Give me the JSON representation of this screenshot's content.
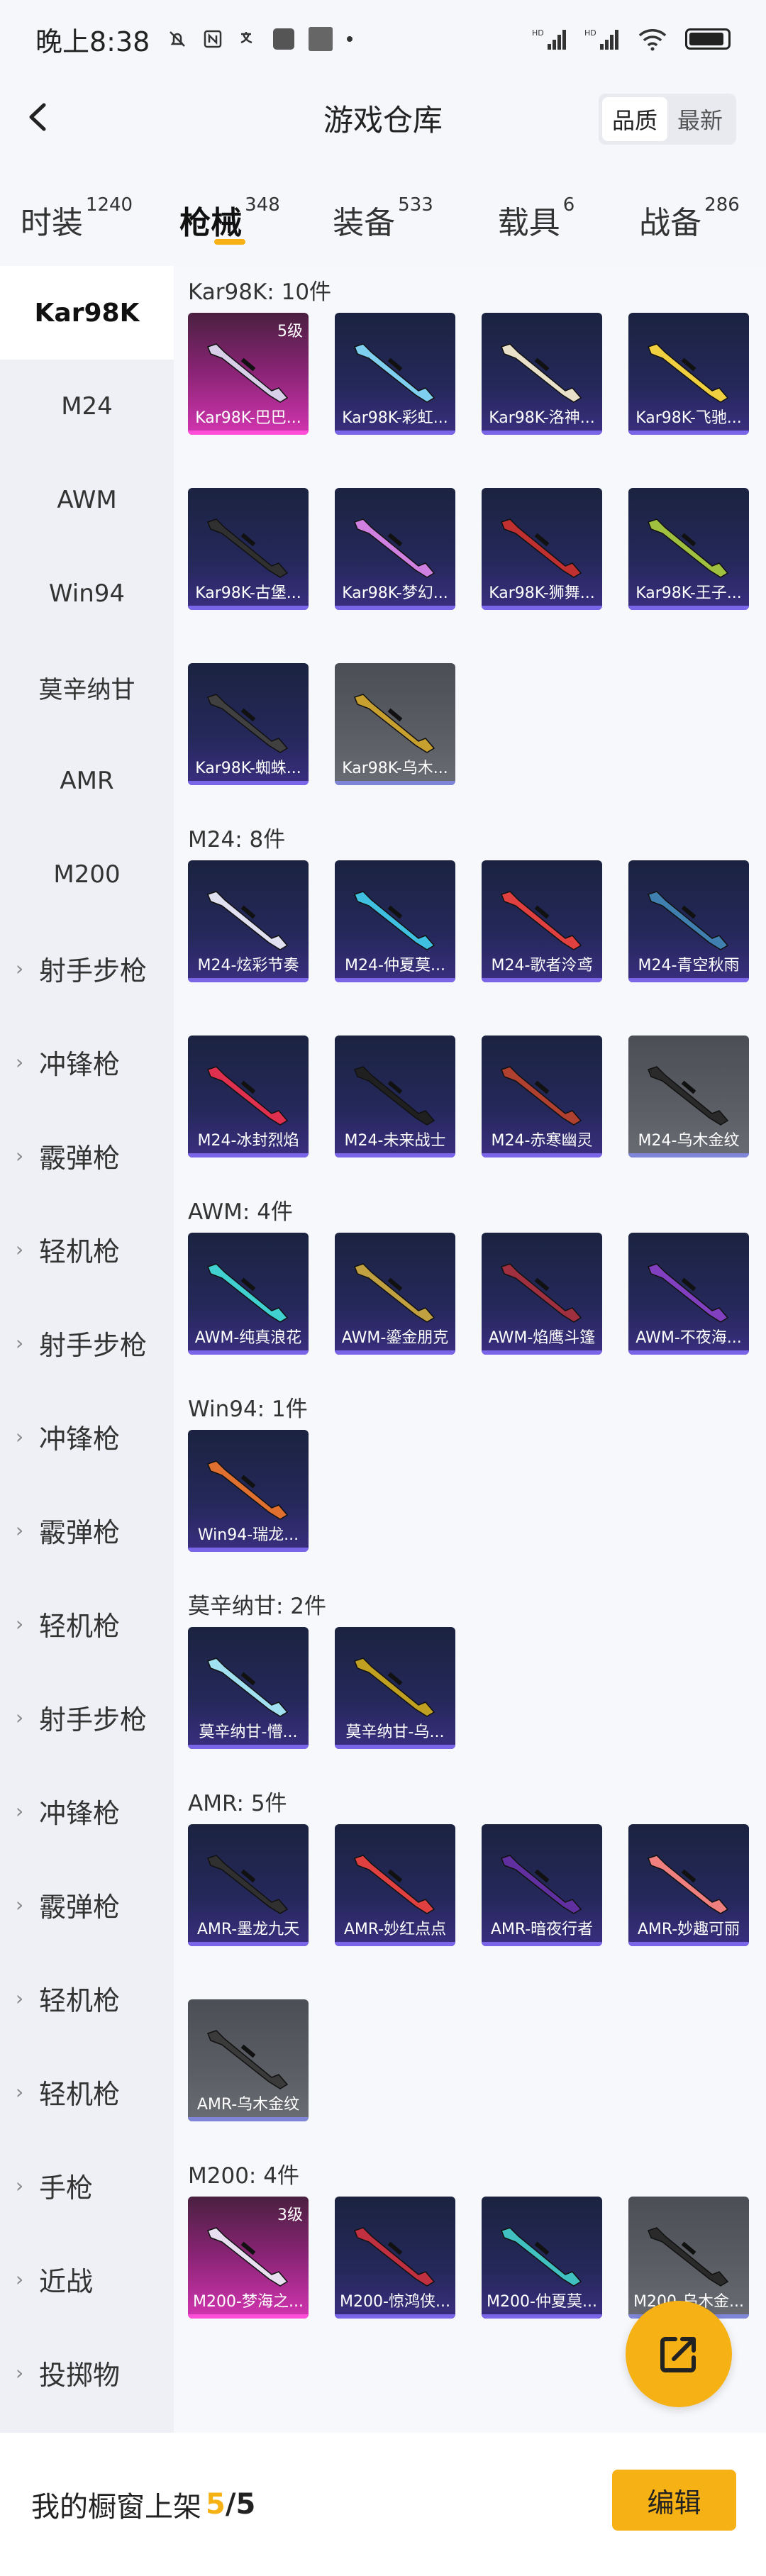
{
  "statusbar": {
    "time": "晚上8:38",
    "signal": "HD"
  },
  "header": {
    "title": "游戏仓库",
    "sort_options": [
      "品质",
      "最新"
    ],
    "sort_active": 0
  },
  "tabs": [
    {
      "label": "时装",
      "count": "1240"
    },
    {
      "label": "枪械",
      "count": "348"
    },
    {
      "label": "装备",
      "count": "533"
    },
    {
      "label": "载具",
      "count": "6"
    },
    {
      "label": "战备",
      "count": "286"
    }
  ],
  "tab_active": 1,
  "sidebar": [
    {
      "label": "Kar98K",
      "chev": false
    },
    {
      "label": "M24",
      "chev": false
    },
    {
      "label": "AWM",
      "chev": false
    },
    {
      "label": "Win94",
      "chev": false
    },
    {
      "label": "莫辛纳甘",
      "chev": false
    },
    {
      "label": "AMR",
      "chev": false
    },
    {
      "label": "M200",
      "chev": false
    },
    {
      "label": "射手步枪",
      "chev": true
    },
    {
      "label": "冲锋枪",
      "chev": true
    },
    {
      "label": "霰弹枪",
      "chev": true
    },
    {
      "label": "轻机枪",
      "chev": true
    },
    {
      "label": "射手步枪",
      "chev": true
    },
    {
      "label": "冲锋枪",
      "chev": true
    },
    {
      "label": "霰弹枪",
      "chev": true
    },
    {
      "label": "轻机枪",
      "chev": true
    },
    {
      "label": "射手步枪",
      "chev": true
    },
    {
      "label": "冲锋枪",
      "chev": true
    },
    {
      "label": "霰弹枪",
      "chev": true
    },
    {
      "label": "轻机枪",
      "chev": true
    },
    {
      "label": "轻机枪",
      "chev": true
    },
    {
      "label": "手枪",
      "chev": true
    },
    {
      "label": "近战",
      "chev": true
    },
    {
      "label": "投掷物",
      "chev": true
    }
  ],
  "groups": [
    {
      "title": "Kar98K: 10件",
      "items": [
        {
          "label": "Kar98K-巴巴...",
          "tier": "pink",
          "level": "5级",
          "color": "#d8d0e8"
        },
        {
          "label": "Kar98K-彩虹...",
          "tier": "blue",
          "level": "",
          "color": "#7fd0f0"
        },
        {
          "label": "Kar98K-洛神...",
          "tier": "blue",
          "level": "",
          "color": "#e8e0c8"
        },
        {
          "label": "Kar98K-飞驰...",
          "tier": "blue",
          "level": "",
          "color": "#f0d040"
        },
        {
          "label": "Kar98K-古堡...",
          "tier": "blue",
          "level": "",
          "color": "#303030"
        },
        {
          "label": "Kar98K-梦幻...",
          "tier": "blue",
          "level": "",
          "color": "#d080e0"
        },
        {
          "label": "Kar98K-狮舞...",
          "tier": "blue",
          "level": "",
          "color": "#c03030"
        },
        {
          "label": "Kar98K-王子...",
          "tier": "blue",
          "level": "",
          "color": "#a0c040"
        },
        {
          "label": "Kar98K-蜘蛛...",
          "tier": "blue",
          "level": "",
          "color": "#404040"
        },
        {
          "label": "Kar98K-乌木...",
          "tier": "grey",
          "level": "",
          "color": "#c8a030"
        }
      ]
    },
    {
      "title": "M24: 8件",
      "items": [
        {
          "label": "M24-炫彩节奏",
          "tier": "blue",
          "level": "",
          "color": "#e0e0f0"
        },
        {
          "label": "M24-仲夏莫...",
          "tier": "blue",
          "level": "",
          "color": "#40c0e0"
        },
        {
          "label": "M24-歌者泠鸢",
          "tier": "blue",
          "level": "",
          "color": "#e04040"
        },
        {
          "label": "M24-青空秋雨",
          "tier": "blue",
          "level": "",
          "color": "#4080b0"
        },
        {
          "label": "M24-冰封烈焰",
          "tier": "blue",
          "level": "",
          "color": "#e03050"
        },
        {
          "label": "M24-未来战士",
          "tier": "blue",
          "level": "",
          "color": "#202020"
        },
        {
          "label": "M24-赤寒幽灵",
          "tier": "blue",
          "level": "",
          "color": "#b04030"
        },
        {
          "label": "M24-乌木金纹",
          "tier": "grey",
          "level": "",
          "color": "#2a2a2a"
        }
      ]
    },
    {
      "title": "AWM: 4件",
      "items": [
        {
          "label": "AWM-纯真浪花",
          "tier": "blue",
          "level": "",
          "color": "#40d0d0"
        },
        {
          "label": "AWM-鎏金朋克",
          "tier": "blue",
          "level": "",
          "color": "#c0a040"
        },
        {
          "label": "AWM-焰鹰斗篷",
          "tier": "blue",
          "level": "",
          "color": "#a03040"
        },
        {
          "label": "AWM-不夜海...",
          "tier": "blue",
          "level": "",
          "color": "#8040c0"
        }
      ]
    },
    {
      "title": "Win94: 1件",
      "items": [
        {
          "label": "Win94-瑞龙...",
          "tier": "blue",
          "level": "",
          "color": "#e07030"
        }
      ]
    },
    {
      "title": "莫辛纳甘: 2件",
      "items": [
        {
          "label": "莫辛纳甘-懵...",
          "tier": "blue",
          "level": "",
          "color": "#a0e0f0"
        },
        {
          "label": "莫辛纳甘-乌...",
          "tier": "blue",
          "level": "",
          "color": "#c0a020"
        }
      ]
    },
    {
      "title": "AMR: 5件",
      "items": [
        {
          "label": "AMR-墨龙九天",
          "tier": "blue",
          "level": "",
          "color": "#303030"
        },
        {
          "label": "AMR-妙红点点",
          "tier": "blue",
          "level": "",
          "color": "#e04040"
        },
        {
          "label": "AMR-暗夜行者",
          "tier": "blue",
          "level": "",
          "color": "#6030a0"
        },
        {
          "label": "AMR-妙趣可丽",
          "tier": "blue",
          "level": "",
          "color": "#f08080"
        },
        {
          "label": "AMR-乌木金纹",
          "tier": "grey",
          "level": "",
          "color": "#3a3a3a"
        }
      ]
    },
    {
      "title": "M200: 4件",
      "items": [
        {
          "label": "M200-梦海之...",
          "tier": "pink",
          "level": "3级",
          "color": "#e8e0f0"
        },
        {
          "label": "M200-惊鸿侠...",
          "tier": "blue",
          "level": "",
          "color": "#c03040"
        },
        {
          "label": "M200-仲夏莫...",
          "tier": "blue",
          "level": "",
          "color": "#40c0c0"
        },
        {
          "label": "M200-乌木金...",
          "tier": "grey",
          "level": "",
          "color": "#2a2a2a"
        }
      ]
    }
  ],
  "bottom": {
    "label": "我的橱窗上架",
    "count_current": "5",
    "count_sep": "/5",
    "edit_label": "编辑"
  },
  "accent_color": "#f6b214"
}
